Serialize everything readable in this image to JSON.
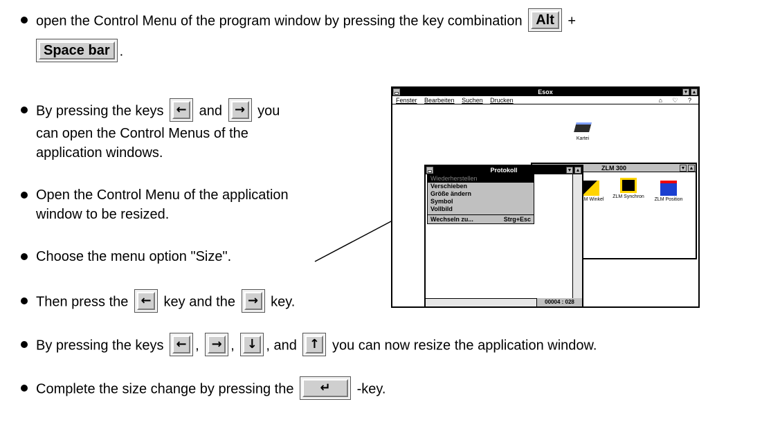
{
  "lines": {
    "l1a": "open the Control Menu of the program window by pressing the key combination",
    "l1b": "+",
    "l2a": ".",
    "l3a": "By pressing the keys",
    "l3b": "and",
    "l3c": "you",
    "l4": "can open the Control Menus of the",
    "l5": "application windows.",
    "l6": "Open the Control Menu of the application",
    "l7": "window to be resized.",
    "l8": "Choose the menu option \"Size\".",
    "l9a": "Then press the",
    "l9b": "key and the",
    "l9c": "key.",
    "l10a": "By pressing the keys",
    "l10b": ",",
    "l10c": ",",
    "l10d": ", and",
    "l10e": "you can now resize the application window.",
    "l11a": "Complete the size change by pressing the",
    "l11b": "-key."
  },
  "keys": {
    "alt": "Alt",
    "space": "Space bar",
    "left": "←",
    "right": "→",
    "down": "↓",
    "up": "↑",
    "enter": "↵"
  },
  "screenshot": {
    "main_title": "Esox",
    "menu": [
      "Fenster",
      "Bearbeiten",
      "Suchen",
      "Drucken"
    ],
    "menu_icons": "⌂ ♡ ?",
    "kartei_label": "Kartei",
    "zlm_title": "ZLM 300",
    "zlm_icons": [
      "ZLM Winkel",
      "ZLM Synchron",
      "ZLM Position"
    ],
    "proto_title": "Protokoll",
    "proto_menu": [
      "Wiederherstellen",
      "Verschieben",
      "Größe ändern",
      "Symbol",
      "Vollbild"
    ],
    "proto_switch": "Wechseln zu...",
    "proto_shortcut": "Strg+Esc",
    "status": "00004 : 028"
  }
}
